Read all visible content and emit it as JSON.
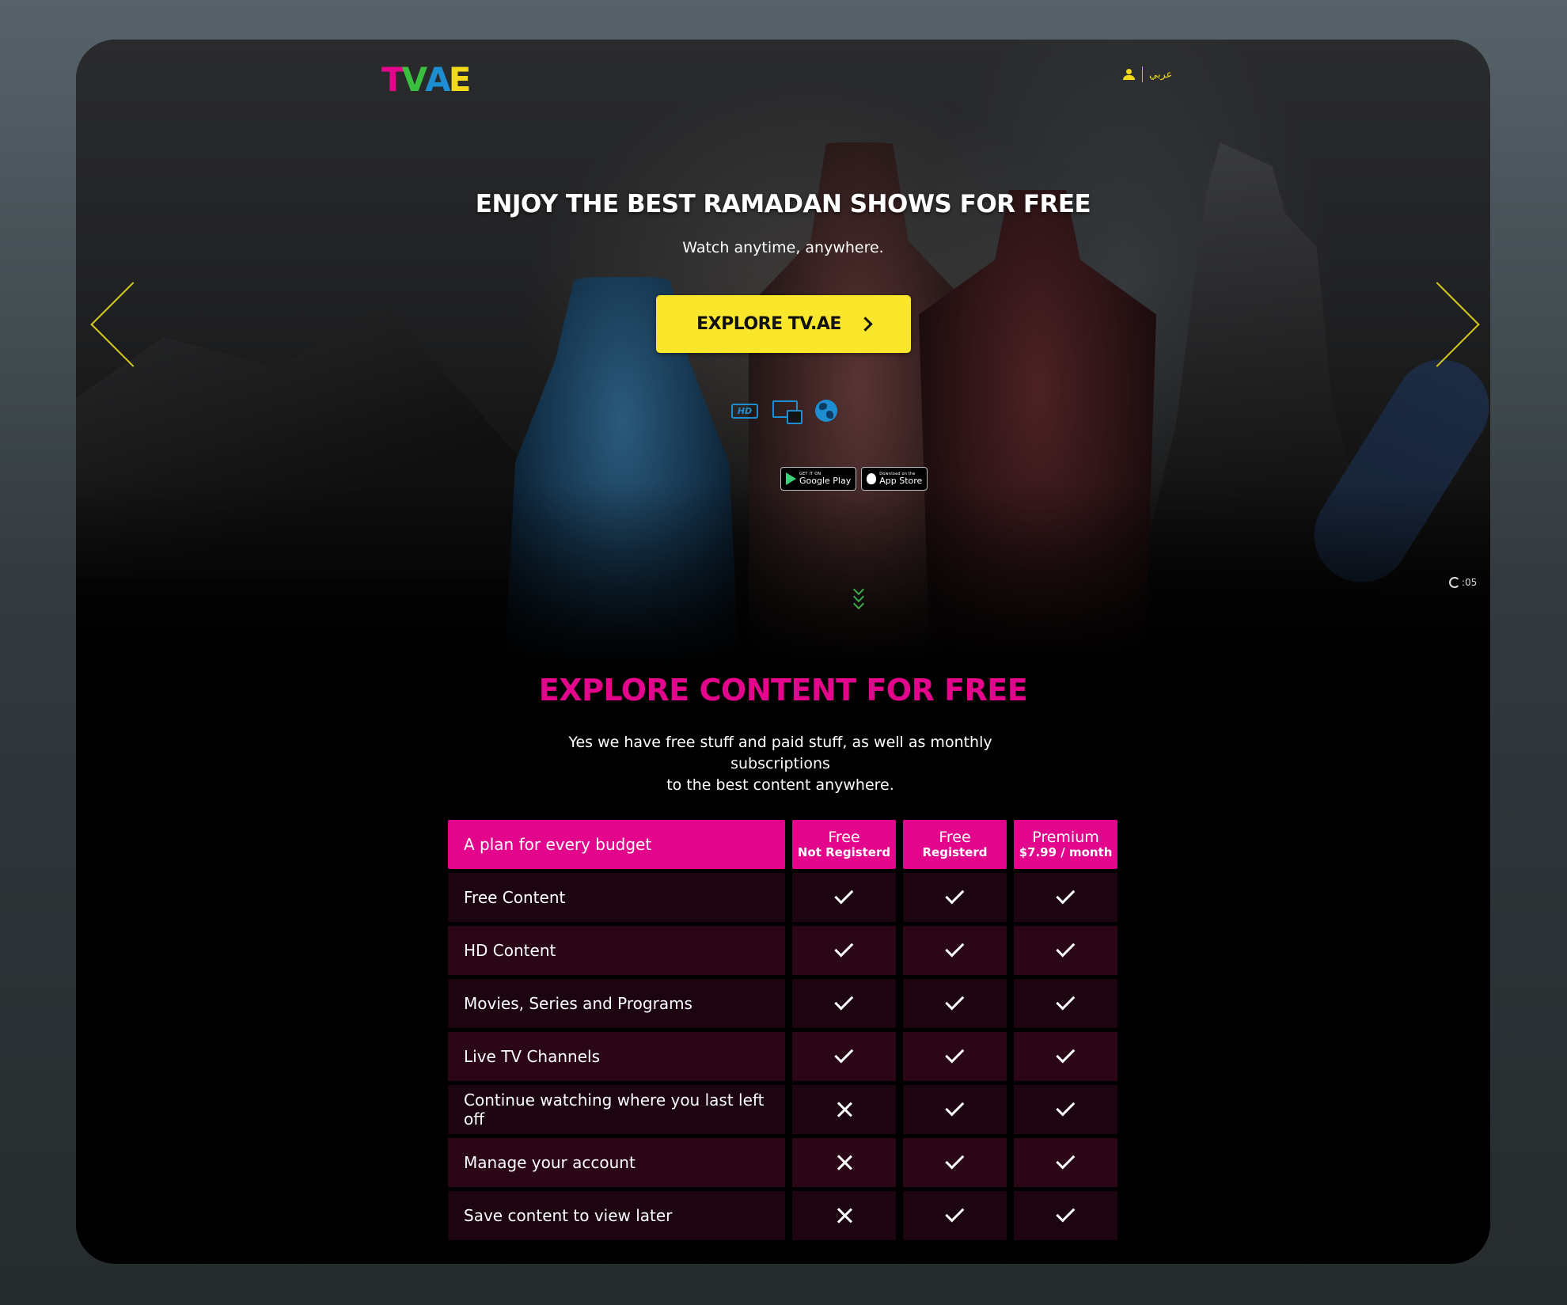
{
  "header": {
    "logo_letters": [
      "T",
      "V",
      "A",
      "E"
    ],
    "logo_colors": [
      "#e3058c",
      "#3bbf3f",
      "#1e8ed3",
      "#f2d91a"
    ],
    "language_label": "عربي"
  },
  "hero": {
    "title": "ENJOY THE BEST RAMADAN SHOWS FOR FREE",
    "subtitle": "Watch anytime, anywhere.",
    "cta_label": "EXPLORE TV.AE",
    "feature_icons": [
      "hd-icon",
      "multi-screen-icon",
      "globe-icon"
    ],
    "google_play": {
      "small": "GET IT ON",
      "big": "Google Play"
    },
    "app_store": {
      "small": "Download on the",
      "big": "App Store"
    },
    "timer": ":05",
    "accent_color": "#fae62a"
  },
  "plans": {
    "title": "EXPLORE CONTENT FOR FREE",
    "description_line1": "Yes we have free stuff and paid stuff, as well as monthly subscriptions",
    "description_line2": "to the best content anywhere.",
    "header_label": "A plan for every budget",
    "columns": [
      {
        "title": "Free",
        "subtitle": "Not Registerd"
      },
      {
        "title": "Free",
        "subtitle": "Registerd"
      },
      {
        "title": "Premium",
        "subtitle": "$7.99 / month"
      }
    ],
    "rows": [
      {
        "label": "Free Content",
        "values": [
          true,
          true,
          true
        ]
      },
      {
        "label": "HD Content",
        "values": [
          true,
          true,
          true
        ]
      },
      {
        "label": "Movies, Series and Programs",
        "values": [
          true,
          true,
          true
        ]
      },
      {
        "label": "Live TV Channels",
        "values": [
          true,
          true,
          true
        ]
      },
      {
        "label": "Continue watching where you last left off",
        "values": [
          false,
          true,
          true
        ]
      },
      {
        "label": "Manage your account",
        "values": [
          false,
          true,
          true
        ]
      },
      {
        "label": "Save content to view later",
        "values": [
          false,
          true,
          true
        ]
      }
    ],
    "brand_color": "#e3058c"
  }
}
